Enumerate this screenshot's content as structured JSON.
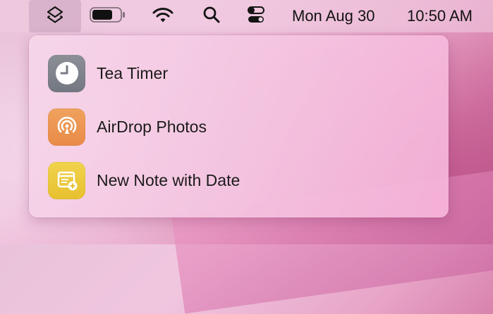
{
  "menubar": {
    "shortcuts_icon": "shortcuts-stack-icon",
    "battery_icon": "battery-icon",
    "wifi_icon": "wifi-icon",
    "search_icon": "spotlight-search-icon",
    "control_center_icon": "control-center-icon",
    "date": "Mon Aug 30",
    "time": "10:50 AM"
  },
  "shortcuts_menu": {
    "items": [
      {
        "label": "Tea Timer",
        "icon": "clock-icon",
        "icon_color": "#7d8088"
      },
      {
        "label": "AirDrop Photos",
        "icon": "airdrop-icon",
        "icon_color": "#ec9350"
      },
      {
        "label": "New Note with Date",
        "icon": "note-add-icon",
        "icon_color": "#ecc93a"
      }
    ]
  }
}
